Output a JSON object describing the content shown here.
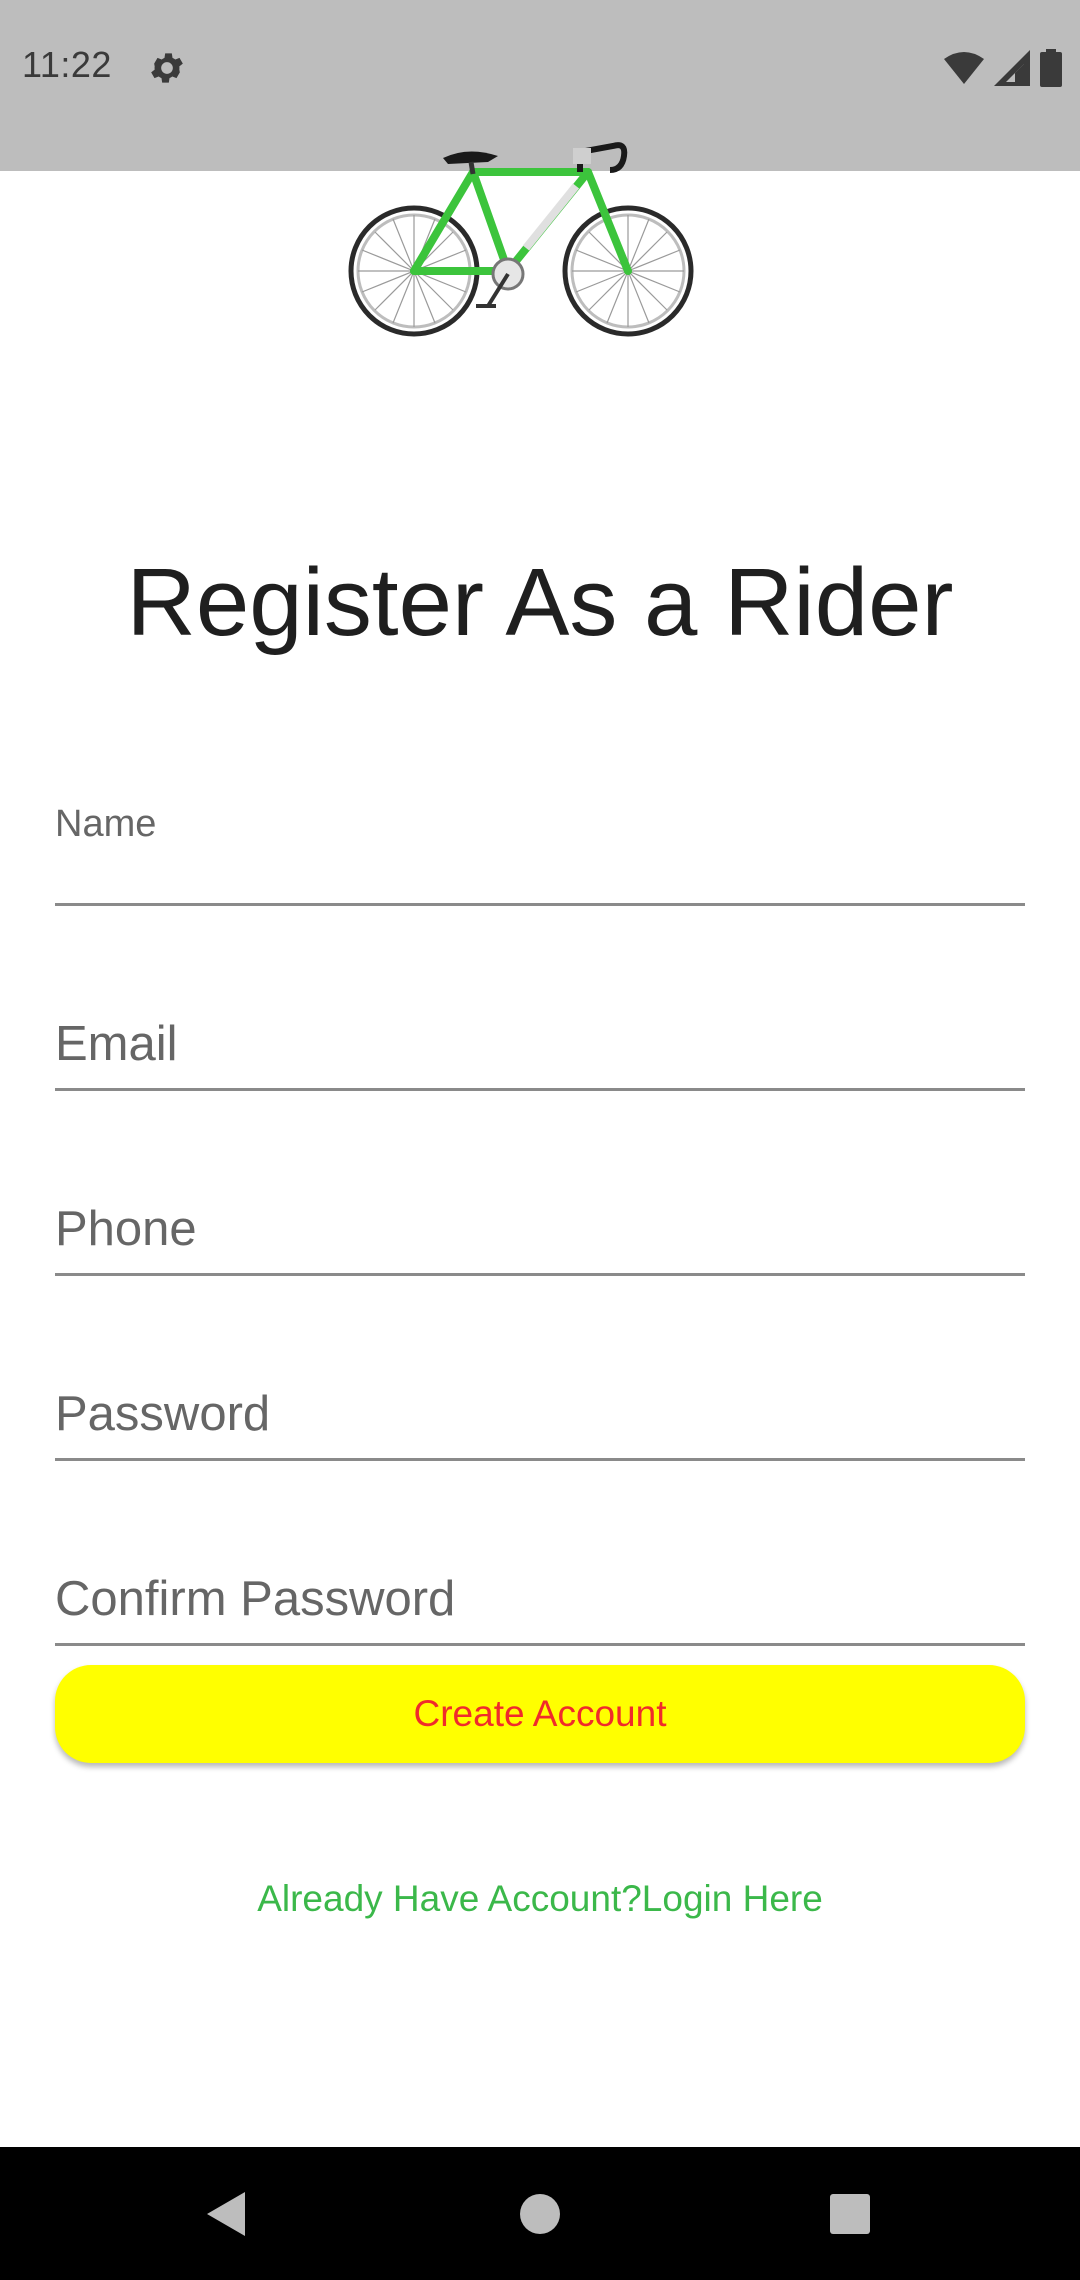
{
  "status_bar": {
    "time": "11:22",
    "icons": [
      "gear-icon",
      "wifi-icon",
      "signal-icon",
      "battery-icon"
    ]
  },
  "header": {
    "logo": "bicycle-icon",
    "title": "Register As a Rider"
  },
  "form": {
    "fields": [
      {
        "label": "Name",
        "value": ""
      },
      {
        "label": "Email",
        "value": ""
      },
      {
        "label": "Phone",
        "value": ""
      },
      {
        "label": "Password",
        "value": ""
      },
      {
        "label": "Confirm Password",
        "value": ""
      }
    ],
    "submit_label": "Create Account",
    "login_link": "Already Have Account?Login Here"
  },
  "navigation": {
    "icons": [
      "back-icon",
      "home-icon",
      "recents-icon"
    ]
  },
  "colors": {
    "status_bar": "#bdbdbd",
    "button_bg": "#ffff00",
    "button_text": "#f02b2b",
    "link_text": "#3bb84a",
    "nav_bar": "#000000"
  }
}
